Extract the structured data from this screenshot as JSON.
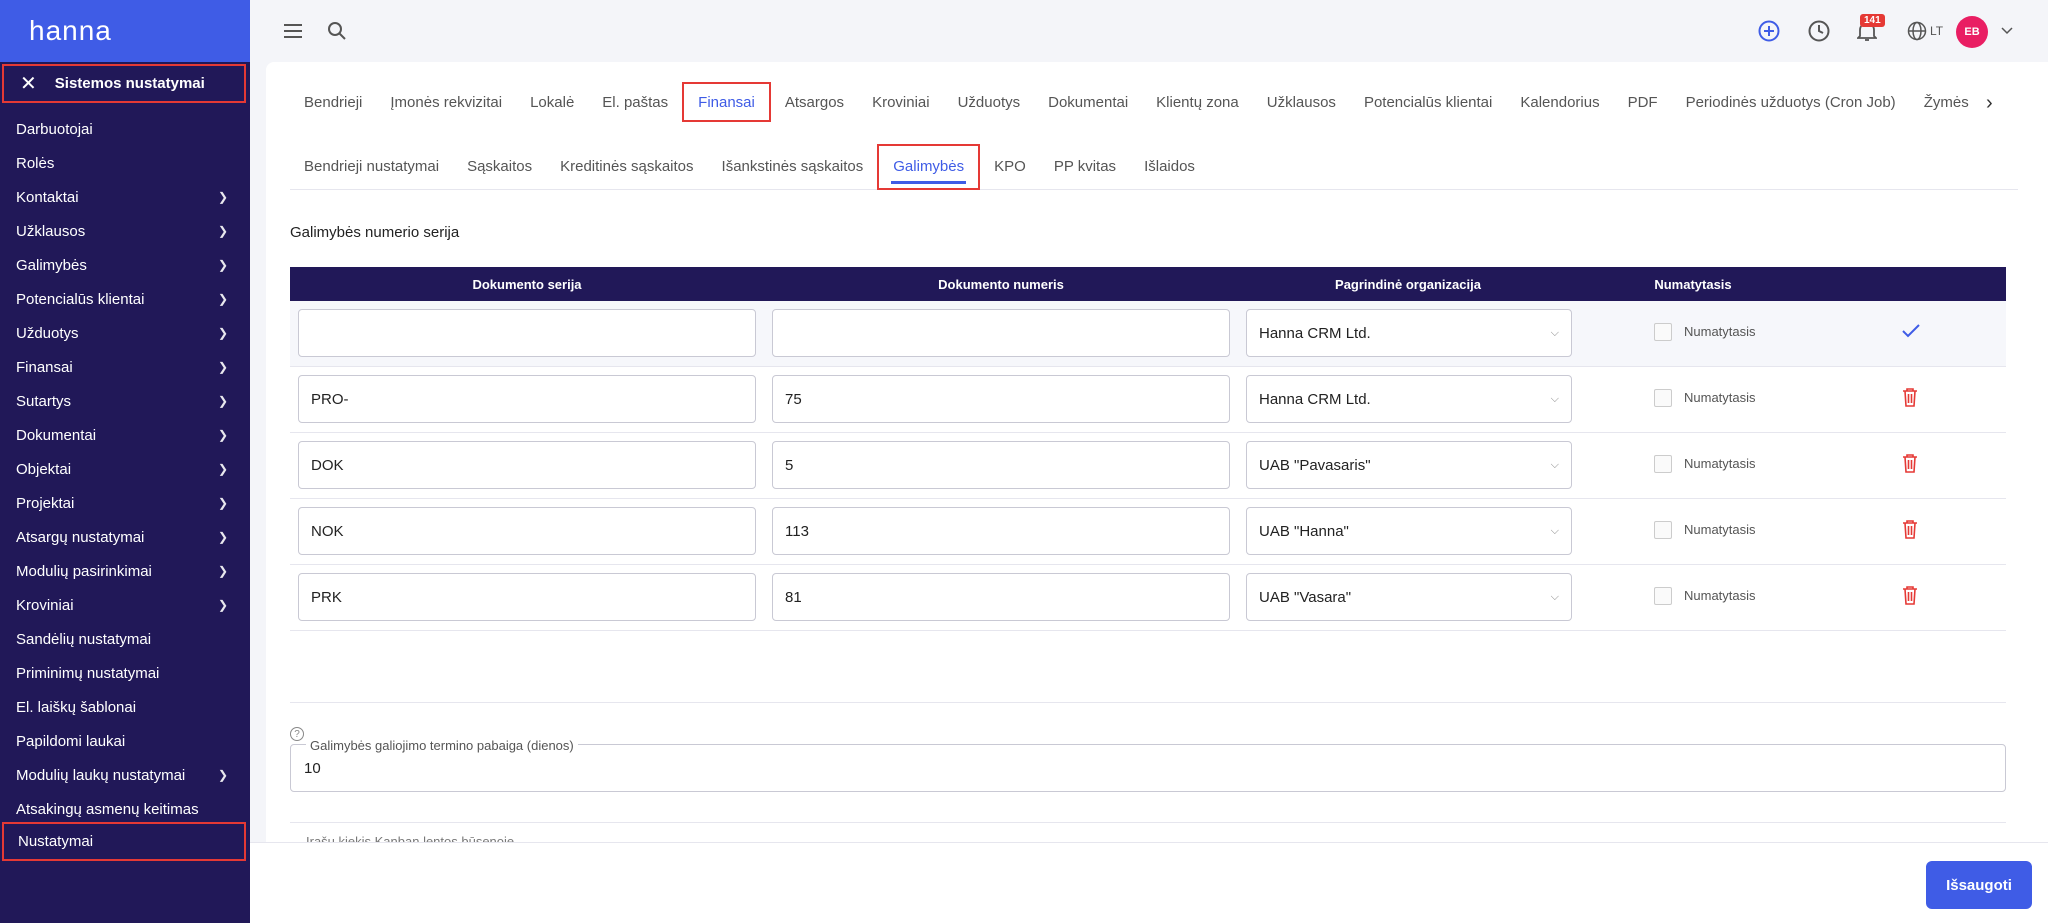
{
  "app": {
    "logo": "hanna"
  },
  "sidebar": {
    "header": "Sistemos nustatymai",
    "items": [
      {
        "label": "Darbuotojai",
        "chevron": false
      },
      {
        "label": "Rolės",
        "chevron": false
      },
      {
        "label": "Kontaktai",
        "chevron": true
      },
      {
        "label": "Užklausos",
        "chevron": true
      },
      {
        "label": "Galimybės",
        "chevron": true
      },
      {
        "label": "Potencialūs klientai",
        "chevron": true
      },
      {
        "label": "Užduotys",
        "chevron": true
      },
      {
        "label": "Finansai",
        "chevron": true
      },
      {
        "label": "Sutartys",
        "chevron": true
      },
      {
        "label": "Dokumentai",
        "chevron": true
      },
      {
        "label": "Objektai",
        "chevron": true
      },
      {
        "label": "Projektai",
        "chevron": true
      },
      {
        "label": "Atsargų nustatymai",
        "chevron": true
      },
      {
        "label": "Modulių pasirinkimai",
        "chevron": true
      },
      {
        "label": "Kroviniai",
        "chevron": true
      },
      {
        "label": "Sandėlių nustatymai",
        "chevron": false
      },
      {
        "label": "Priminimų nustatymai",
        "chevron": false
      },
      {
        "label": "El. laiškų šablonai",
        "chevron": false
      },
      {
        "label": "Papildomi laukai",
        "chevron": false
      },
      {
        "label": "Modulių laukų nustatymai",
        "chevron": true
      },
      {
        "label": "Atsakingų asmenų keitimas",
        "chevron": false
      }
    ],
    "selected": "Nustatymai"
  },
  "topbar": {
    "notifications": "141",
    "language": "LT",
    "avatar": "EB"
  },
  "tabs1": [
    "Bendrieji",
    "Įmonės rekvizitai",
    "Lokalė",
    "El. paštas",
    "Finansai",
    "Atsargos",
    "Kroviniai",
    "Užduotys",
    "Dokumentai",
    "Klientų zona",
    "Užklausos",
    "Potencialūs klientai",
    "Kalendorius",
    "PDF",
    "Periodinės užduotys (Cron Job)",
    "Žymės"
  ],
  "tabs1_active": 4,
  "tabs2": [
    "Bendrieji nustatymai",
    "Sąskaitos",
    "Kreditinės sąskaitos",
    "Išankstinės sąskaitos",
    "Galimybės",
    "KPO",
    "PP kvitas",
    "Išlaidos"
  ],
  "tabs2_active": 4,
  "section_title": "Galimybės numerio serija",
  "table": {
    "headers": [
      "Dokumento serija",
      "Dokumento numeris",
      "Pagrindinė organizacija",
      "Numatytasis"
    ],
    "rows": [
      {
        "series": "",
        "number": "",
        "org": "Hanna CRM Ltd.",
        "default_label": "Numatytasis",
        "action": "check"
      },
      {
        "series": "PRO-",
        "number": "75",
        "org": "Hanna CRM Ltd.",
        "default_label": "Numatytasis",
        "action": "delete"
      },
      {
        "series": "DOK",
        "number": "5",
        "org": "UAB \"Pavasaris\"",
        "default_label": "Numatytasis",
        "action": "delete"
      },
      {
        "series": "NOK",
        "number": "113",
        "org": "UAB \"Hanna\"",
        "default_label": "Numatytasis",
        "action": "delete"
      },
      {
        "series": "PRK",
        "number": "81",
        "org": "UAB \"Vasara\"",
        "default_label": "Numatytasis",
        "action": "delete"
      }
    ]
  },
  "validity_field": {
    "label": "Galimybės galiojimo termino pabaiga (dienos)",
    "value": "10"
  },
  "cut_label": "Įrašų kiekis Kanban lentos būsenoje",
  "save_label": "Išsaugoti"
}
